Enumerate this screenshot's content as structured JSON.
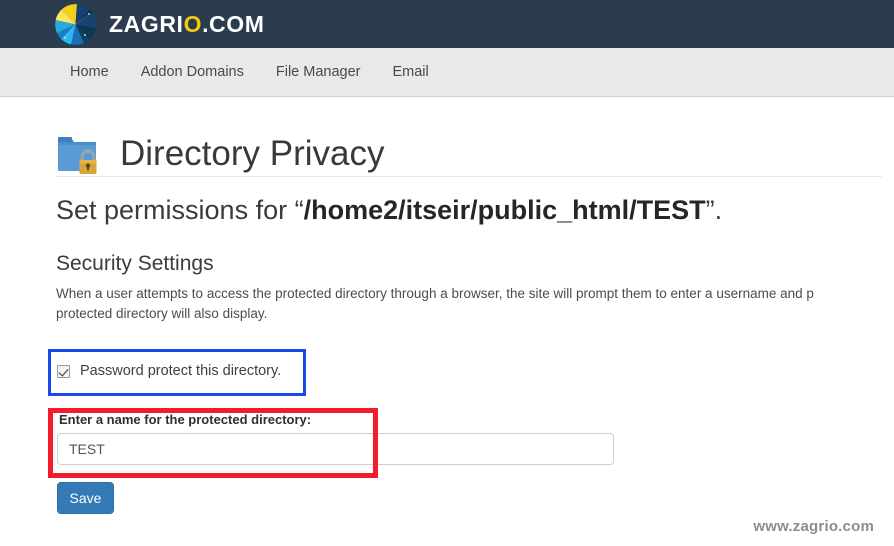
{
  "header": {
    "logo_icon": "zagrio-globe-logo-icon",
    "brand_prefix": "ZAGRI",
    "brand_highlight": "O",
    "brand_suffix": ".COM"
  },
  "nav": {
    "items": [
      {
        "label": "Home",
        "name": "nav-item-home"
      },
      {
        "label": "Addon Domains",
        "name": "nav-item-addon-domains"
      },
      {
        "label": "File Manager",
        "name": "nav-item-file-manager"
      },
      {
        "label": "Email",
        "name": "nav-item-email"
      }
    ]
  },
  "page": {
    "icon": "folder-lock-icon",
    "title": "Directory Privacy",
    "subheading_prefix": "Set permissions for “",
    "subheading_path": "/home2/itseir/public_html/TEST",
    "subheading_suffix": "”.",
    "section_title": "Security Settings",
    "section_description": "When a user attempts to access the protected directory through a browser, the site will prompt them to enter a username and p\nprotected directory will also display."
  },
  "form": {
    "checkbox": {
      "label": "Password protect this directory.",
      "checked": true
    },
    "field_label": "Enter a name for the protected directory:",
    "field_value": "TEST",
    "field_placeholder": "",
    "save_label": "Save"
  },
  "annotations": {
    "blue_box_color": "#1b48e8",
    "red_box_color": "#f41b2e"
  },
  "footer": {
    "watermark": "www.zagrio.com"
  },
  "colors": {
    "header_bg": "#2a3c4e",
    "nav_bg": "#e9e9e9",
    "brand_accent": "#f6c90e",
    "button_primary": "#337ab7",
    "folder_blue": "#5b9bd5",
    "lock_gold": "#d8a43a"
  }
}
